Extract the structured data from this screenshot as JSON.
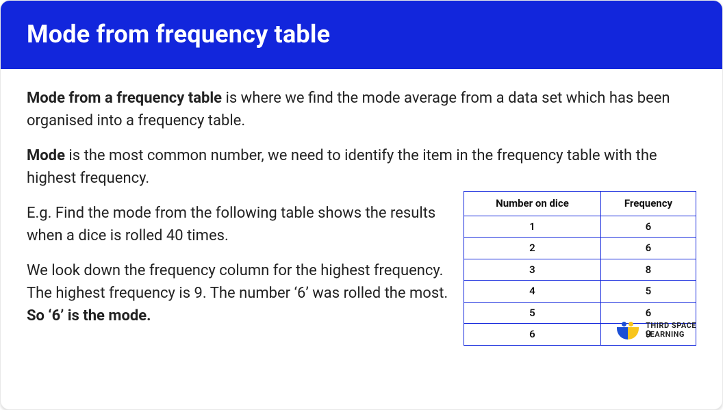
{
  "header": {
    "title": "Mode from frequency table"
  },
  "body": {
    "p1_bold": "Mode from a frequency table",
    "p1_rest": " is where we find the mode average from a data set which has been organised into a frequency table.",
    "p2_bold": "Mode",
    "p2_rest": " is the most common number, we need to identify the item in the frequency table with the highest frequency.",
    "p3": "E.g. Find the mode from the following table shows the results when a dice is rolled 40 times.",
    "p4_a": "We look down the frequency column for the highest frequency. The highest frequency is 9.  The number ‘",
    "p4_b": "6",
    "p4_c": "’ was rolled the most.  ",
    "p4_d": "So ‘6’ is the mode."
  },
  "table": {
    "col1": "Number on dice",
    "col2": "Frequency",
    "rows": [
      {
        "n": "1",
        "f": "6"
      },
      {
        "n": "2",
        "f": "6"
      },
      {
        "n": "3",
        "f": "8"
      },
      {
        "n": "4",
        "f": "5"
      },
      {
        "n": "5",
        "f": "6"
      },
      {
        "n": "6",
        "f": "9"
      }
    ]
  },
  "logo": {
    "line1": "THIRD SPACE",
    "line2": "LEARNING"
  },
  "chart_data": {
    "type": "table",
    "title": "Results when a dice is rolled 40 times",
    "columns": [
      "Number on dice",
      "Frequency"
    ],
    "rows": [
      [
        1,
        6
      ],
      [
        2,
        6
      ],
      [
        3,
        8
      ],
      [
        4,
        5
      ],
      [
        5,
        6
      ],
      [
        6,
        9
      ]
    ],
    "mode_value": 6,
    "mode_frequency": 9,
    "total_rolls": 40
  }
}
